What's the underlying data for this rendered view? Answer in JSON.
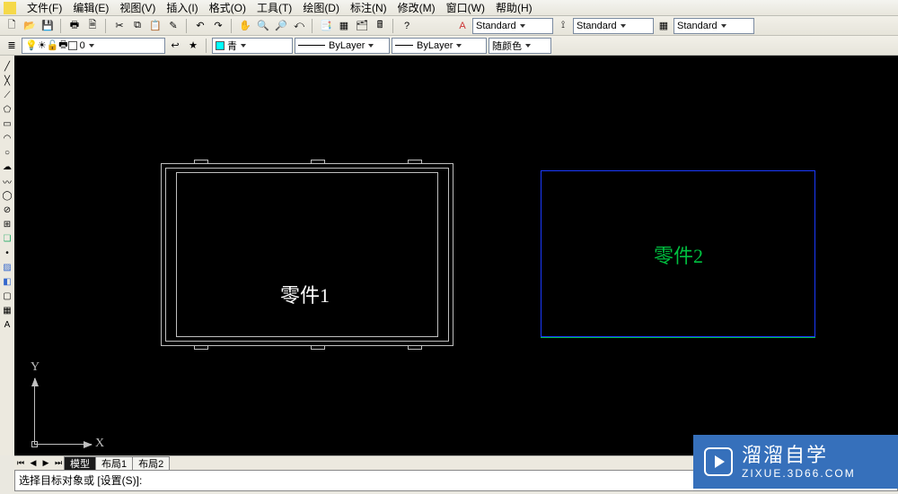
{
  "menu": {
    "items": [
      "文件(F)",
      "编辑(E)",
      "视图(V)",
      "插入(I)",
      "格式(O)",
      "工具(T)",
      "绘图(D)",
      "标注(N)",
      "修改(M)",
      "窗口(W)",
      "帮助(H)"
    ]
  },
  "toolbar1": {
    "style1": "Standard",
    "style2": "Standard",
    "style3": "Standard"
  },
  "toolbar2": {
    "layer": "0",
    "color_name": "青",
    "linetype": "ByLayer",
    "lineweight": "ByLayer",
    "plotstyle": "随颜色"
  },
  "drawing": {
    "part1_label": "零件1",
    "part2_label": "零件2",
    "ucs_x": "X",
    "ucs_y": "Y"
  },
  "tabs": {
    "t0": "模型",
    "t1": "布局1",
    "t2": "布局2"
  },
  "command": {
    "prompt": "选择目标对象或 [设置(S)]:"
  },
  "watermark": {
    "title": "溜溜自学",
    "url": "ZIXUE.3D66.COM"
  }
}
